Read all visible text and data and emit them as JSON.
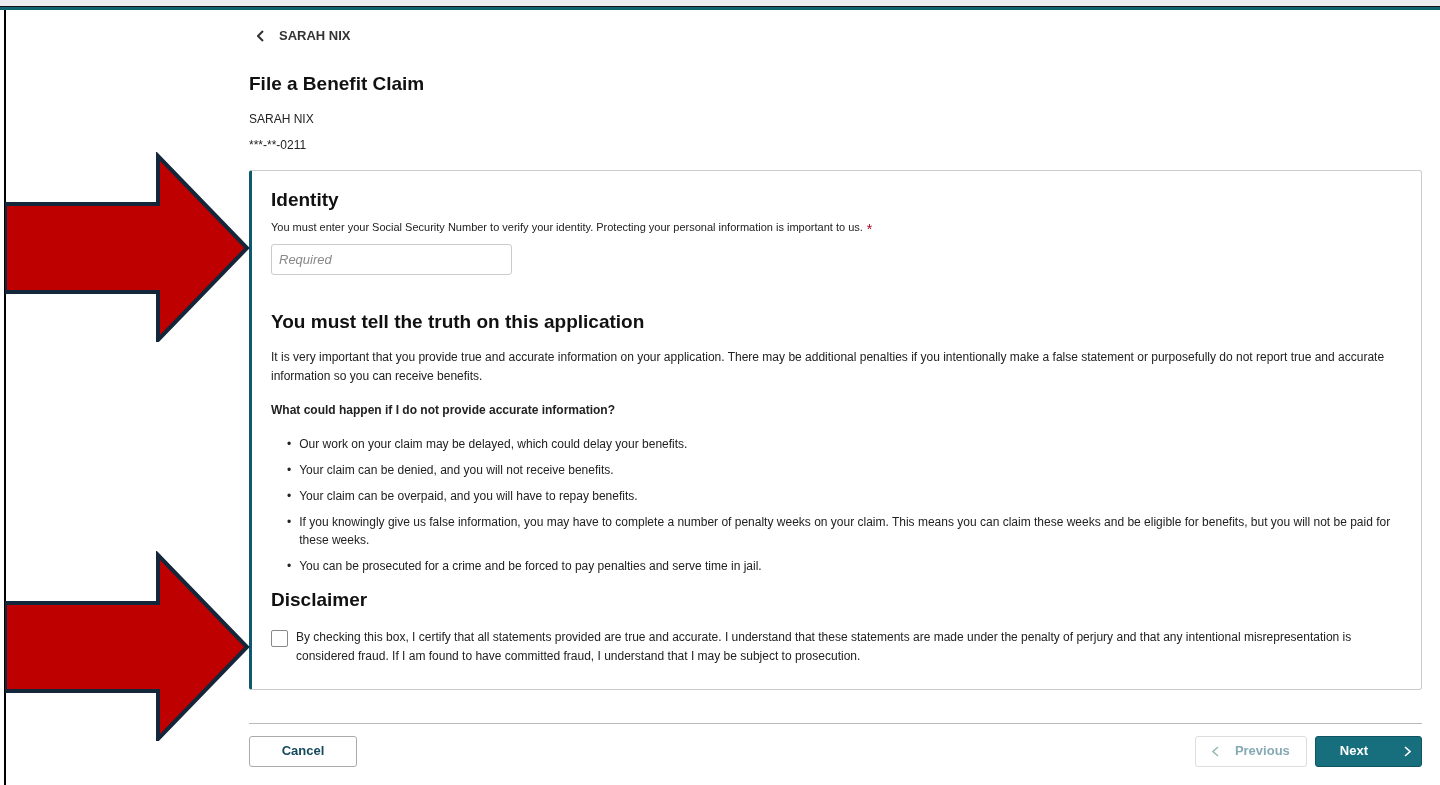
{
  "back_link": {
    "label": "SARAH NIX"
  },
  "page_title": "File a Benefit Claim",
  "claimant": {
    "name": "SARAH NIX",
    "ssn": "***-**-0211"
  },
  "identity": {
    "heading": "Identity",
    "prompt": "You must enter your Social Security Number to verify your identity. Protecting your personal information is important to us.",
    "required": true,
    "required_mark": "*",
    "placeholder": "Required"
  },
  "truth": {
    "heading": "You must tell the truth on this application",
    "paragraph": "It is very important that you provide true and accurate information on your application. There may be additional penalties if you intentionally make a false statement or purposefully do not report true and accurate information so you can receive benefits.",
    "question": "What could happen if I do not provide accurate information?",
    "bullets": [
      {
        "marker": "•",
        "text": "Our work on your claim may be delayed, which could delay your benefits."
      },
      {
        "marker": "•",
        "text": "Your claim can be denied, and you will not receive benefits."
      },
      {
        "marker": "•",
        "text": "Your claim can be overpaid, and you will have to repay benefits."
      },
      {
        "marker": "•",
        "text": "If you knowingly give us false information, you may have to complete a number of penalty weeks on your claim. This means you can claim these weeks and be eligible for benefits, but you will not be paid for these weeks."
      },
      {
        "marker": "•",
        "text": "You can be prosecuted for a crime and be forced to pay penalties and serve time in jail."
      }
    ]
  },
  "disclaimer": {
    "heading": "Disclaimer",
    "checked": false,
    "label": "By checking this box, I certify that all statements provided are true and accurate. I understand that these statements are made under the penalty of perjury and that any intentional misrepresentation is considered fraud. If I am found to have committed fraud, I understand that I may be subject to prosecution."
  },
  "footer_buttons": [
    {
      "kind": "cancel",
      "label": "Cancel",
      "disabled": false
    },
    {
      "kind": "previous",
      "label": "Previous",
      "disabled": true
    },
    {
      "kind": "next",
      "label": "Next",
      "disabled": false
    }
  ],
  "annotations": [
    {
      "kind": "arrow"
    },
    {
      "kind": "arrow"
    }
  ]
}
